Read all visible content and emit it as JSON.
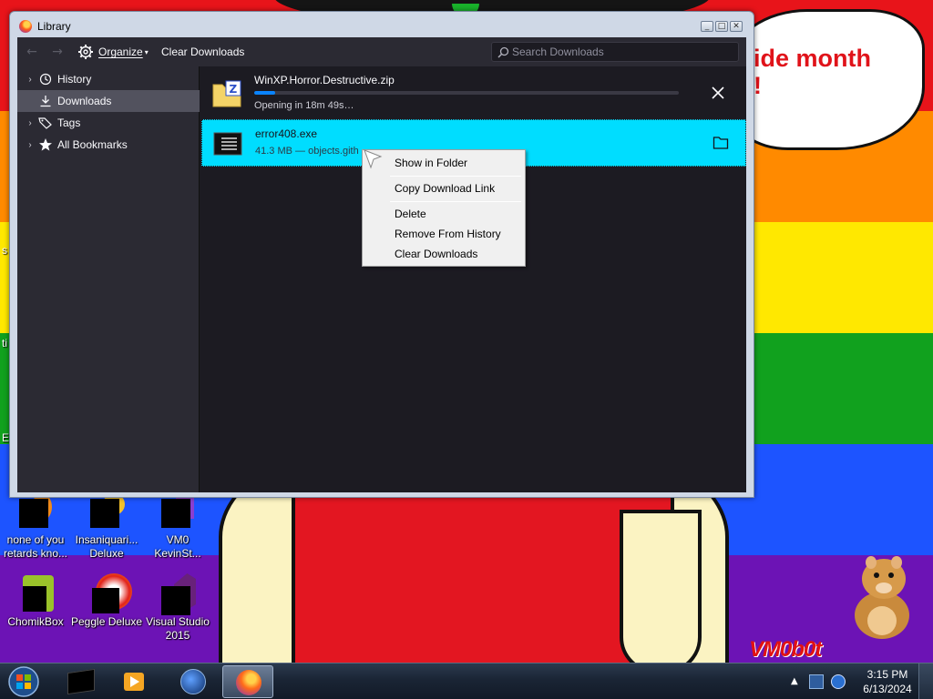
{
  "window": {
    "title": "Library",
    "buttons": {
      "minimize": "_",
      "maximize": "□",
      "close": "✕"
    }
  },
  "toolbar": {
    "organize_label": "Organize",
    "clear_downloads_label": "Clear Downloads",
    "search_placeholder": "Search Downloads"
  },
  "sidebar": {
    "items": [
      {
        "label": "History",
        "icon": "clock-icon",
        "selected": false
      },
      {
        "label": "Downloads",
        "icon": "download-icon",
        "selected": true
      },
      {
        "label": "Tags",
        "icon": "tag-icon",
        "selected": false
      },
      {
        "label": "All Bookmarks",
        "icon": "star-icon",
        "selected": false
      }
    ]
  },
  "downloads": [
    {
      "name": "WinXP.Horror.Destructive.zip",
      "status": "Opening in 18m 49s…",
      "progress": 0.05,
      "icon": "zip-folder-icon"
    },
    {
      "name": "error408.exe",
      "status": "41.3 MB — objects.gith",
      "icon": "exe-file-icon",
      "selected": true
    }
  ],
  "context_menu": {
    "items": [
      "Show in Folder",
      "Copy Download Link",
      "Delete",
      "Remove From History",
      "Clear Downloads"
    ]
  },
  "desktop": {
    "speech_text": "ide month\n!",
    "watermark": "VM0b0t",
    "edge_chars": [
      "s",
      "ti",
      "E"
    ],
    "icons": [
      {
        "label": "none of you\nretards kno..."
      },
      {
        "label": "Insaniquari...\nDeluxe"
      },
      {
        "label": "VM0\nKevinSt..."
      },
      {
        "label": "ChomikBox"
      },
      {
        "label": "Peggle Deluxe"
      },
      {
        "label": "Visual Studio\n2015"
      }
    ]
  },
  "taskbar": {
    "clock_time": "3:15 PM",
    "clock_date": "6/13/2024"
  },
  "colors": {
    "accent": "#0a84ff",
    "selected_row": "#00ddff",
    "panel_bg": "#1c1b22",
    "toolbar_bg": "#2b2a33"
  }
}
